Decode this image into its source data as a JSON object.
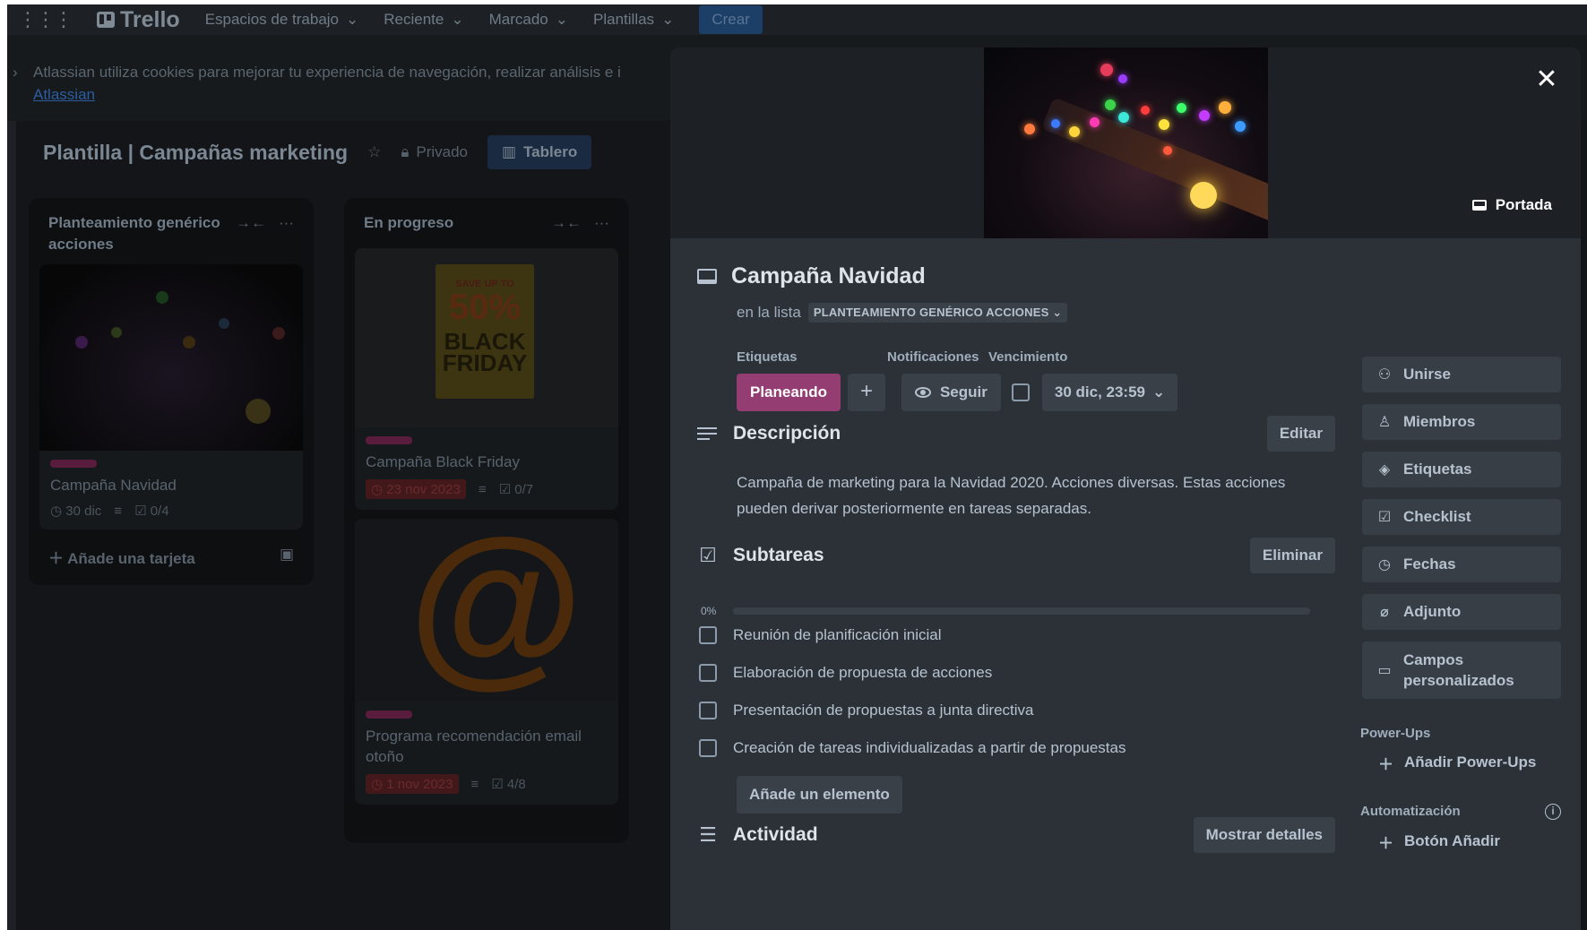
{
  "topnav": {
    "brand": "Trello",
    "items": [
      "Espacios de trabajo",
      "Reciente",
      "Marcado",
      "Plantillas"
    ],
    "create_label": "Crear"
  },
  "cookie_banner": {
    "text": "Atlassian utiliza cookies para mejorar tu experiencia de navegación, realizar análisis e i",
    "link": "Atlassian"
  },
  "board": {
    "title": "Plantilla | Campañas marketing",
    "visibility": "Privado",
    "view": "Tablero",
    "lists": [
      {
        "title": "Planteamiento genérico acciones",
        "card": {
          "title": "Campaña Navidad",
          "due": "30 dic",
          "checklist": "0/4"
        },
        "add_card": "Añade una tarjeta"
      },
      {
        "title": "En progreso",
        "cards": [
          {
            "title": "Campaña Black Friday",
            "due": "23 nov 2023",
            "checklist": "0/7",
            "image_text": [
              "SAVE UP TO",
              "50%",
              "BLACK",
              "FRIDAY"
            ]
          },
          {
            "title": "Programa recomendación email otoño",
            "due": "1 nov 2023",
            "checklist": "4/8",
            "image_text": "@"
          }
        ]
      }
    ]
  },
  "modal": {
    "cover_button": "Portada",
    "title": "Campaña Navidad",
    "in_list_prefix": "en la lista",
    "list_name": "PLANTEAMIENTO GENÉRICO ACCIONES",
    "labels_heading": "Etiquetas",
    "notifications_heading": "Notificaciones",
    "due_heading": "Vencimiento",
    "label_value": "Planeando",
    "label_color": "#943d73",
    "follow_label": "Seguir",
    "due_value": "30 dic, 23:59",
    "description": {
      "heading": "Descripción",
      "edit_label": "Editar",
      "text": "Campaña de marketing para la Navidad 2020. Acciones diversas. Estas acciones pueden derivar posteriormente en tareas separadas."
    },
    "checklist": {
      "heading": "Subtareas",
      "delete_label": "Eliminar",
      "progress_label": "0%",
      "progress": 0,
      "items": [
        "Reunión de planificación inicial",
        "Elaboración de propuesta de acciones",
        "Presentación de propuestas a junta directiva",
        "Creación de tareas individualizadas a partir de propuestas"
      ],
      "add_item_label": "Añade un elemento"
    },
    "activity": {
      "heading": "Actividad",
      "details_label": "Mostrar detalles"
    },
    "sidebar": {
      "buttons": [
        {
          "label": "Unirse",
          "icon": "user-plus-icon"
        },
        {
          "label": "Miembros",
          "icon": "user-icon"
        },
        {
          "label": "Etiquetas",
          "icon": "tag-icon"
        },
        {
          "label": "Checklist",
          "icon": "checkbox-icon"
        },
        {
          "label": "Fechas",
          "icon": "clock-icon"
        },
        {
          "label": "Adjunto",
          "icon": "paperclip-icon"
        },
        {
          "label": "Campos personalizados",
          "icon": "custom-fields-icon"
        }
      ],
      "powerups_heading": "Power-Ups",
      "powerups_add": "Añadir Power-Ups",
      "automation_heading": "Automatización",
      "automation_add": "Botón Añadir"
    }
  }
}
